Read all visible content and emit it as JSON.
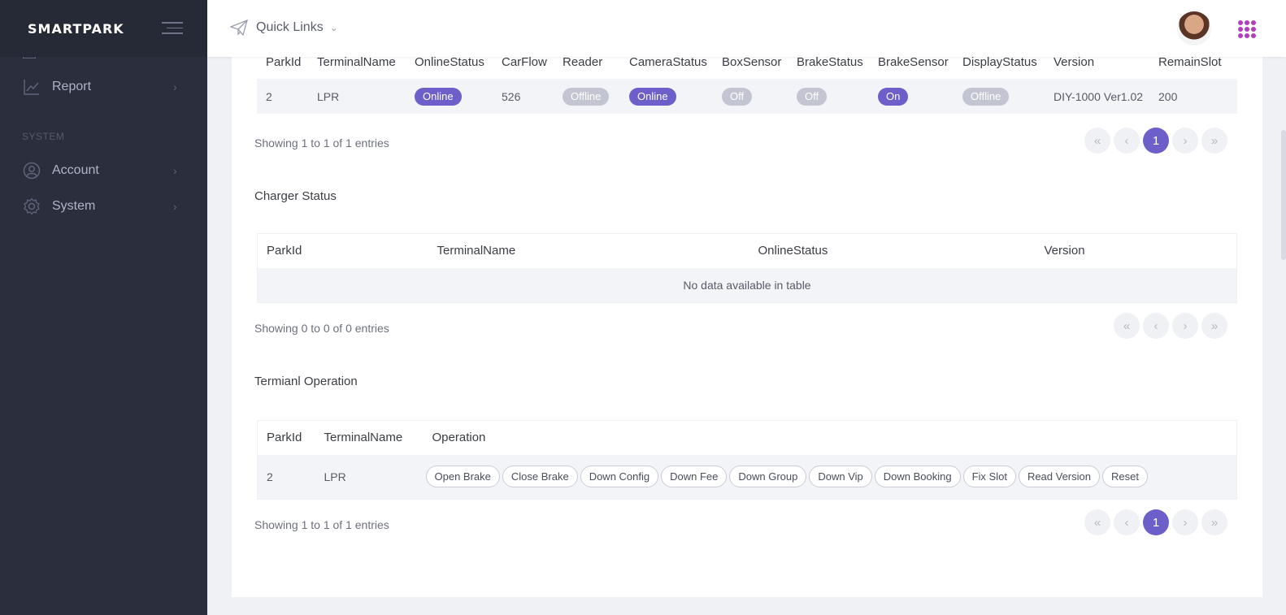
{
  "brand": "SMARTPARK",
  "sidebar": {
    "items": [
      {
        "label": "Report",
        "icon": "chart-line-icon"
      },
      {
        "label": "Account",
        "icon": "user-circle-icon"
      },
      {
        "label": "System",
        "icon": "gear-icon"
      }
    ],
    "section_label": "SYSTEM"
  },
  "topbar": {
    "quick_links": "Quick Links"
  },
  "terminal_status": {
    "columns": [
      "ParkId",
      "TerminalName",
      "OnlineStatus",
      "CarFlow",
      "Reader",
      "CameraStatus",
      "BoxSensor",
      "BrakeStatus",
      "BrakeSensor",
      "DisplayStatus",
      "Version",
      "RemainSlot"
    ],
    "row": {
      "parkid": "2",
      "terminal": "LPR",
      "online": "Online",
      "carflow": "526",
      "reader": "Offline",
      "camera": "Online",
      "box": "Off",
      "brake": "Off",
      "brake_sensor": "On",
      "display": "Offline",
      "version": "DIY-1000 Ver1.02",
      "remain": "200"
    },
    "info": "Showing 1 to 1 of 1 entries",
    "page": "1"
  },
  "charger_status": {
    "title": "Charger Status",
    "columns": [
      "ParkId",
      "TerminalName",
      "OnlineStatus",
      "Version"
    ],
    "empty": "No data available in table",
    "info": "Showing 0 to 0 of 0 entries"
  },
  "terminal_operation": {
    "title": "Termianl Operation",
    "columns": [
      "ParkId",
      "TerminalName",
      "Operation"
    ],
    "row": {
      "parkid": "2",
      "terminal": "LPR"
    },
    "buttons": [
      "Open Brake",
      "Close Brake",
      "Down Config",
      "Down Fee",
      "Down Group",
      "Down Vip",
      "Down Booking",
      "Fix Slot",
      "Read Version",
      "Reset"
    ],
    "info": "Showing 1 to 1 of 1 entries",
    "page": "1"
  },
  "pager_glyphs": {
    "first": "«",
    "prev": "‹",
    "next": "›",
    "last": "»"
  },
  "colors": {
    "accent": "#6c5fc9",
    "sidebar": "#2b2e3d",
    "apps": "#b33fc0"
  }
}
